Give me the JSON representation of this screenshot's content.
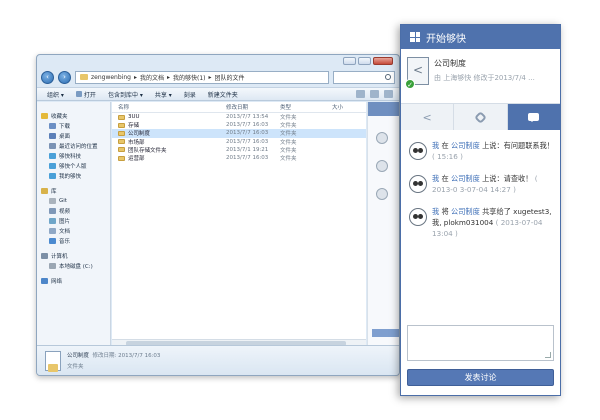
{
  "explorer": {
    "address": [
      "zengwenbing",
      "我的文档",
      "我的够快(1)",
      "团队的文件"
    ],
    "toolbar": {
      "organize": "组织 ▾",
      "open": "打开",
      "include_in_library": "包含到库中 ▾",
      "share": "共享 ▾",
      "burn": "刻录",
      "new_folder": "新建文件夹"
    },
    "nav": [
      {
        "label": "收藏夹",
        "head": true,
        "color": "#e4b93a"
      },
      {
        "label": "下载",
        "color": "#6c8fc4"
      },
      {
        "label": "桌面",
        "color": "#5b7fb8"
      },
      {
        "label": "最近访问的位置",
        "color": "#7b93b5"
      },
      {
        "label": "够快科技",
        "color": "#4aa0d8"
      },
      {
        "label": "够快个人版",
        "color": "#4aa0d8"
      },
      {
        "label": "我的够快",
        "color": "#4aa0d8"
      },
      {
        "label": "库",
        "head": true,
        "color": "#d8b24a"
      },
      {
        "label": "Git",
        "color": "#aab3bd"
      },
      {
        "label": "视频",
        "color": "#7f98b8"
      },
      {
        "label": "图片",
        "color": "#6fa6c9"
      },
      {
        "label": "文档",
        "color": "#8fa8c6"
      },
      {
        "label": "音乐",
        "color": "#4b8ad0"
      },
      {
        "label": "计算机",
        "head": true,
        "color": "#7c8fa6"
      },
      {
        "label": "本地磁盘 (C:)",
        "color": "#9aa6b3"
      },
      {
        "label": "网络",
        "head": true,
        "color": "#4d86c9"
      }
    ],
    "columns": {
      "name": "名称",
      "modified": "修改日期",
      "type": "类型",
      "size": "大小"
    },
    "files": [
      {
        "name": "3UU",
        "date": "2013/7/7 13:54",
        "type": "文件夹"
      },
      {
        "name": "存储",
        "date": "2013/7/7 16:03",
        "type": "文件夹"
      },
      {
        "name": "公司制度",
        "date": "2013/7/7 16:03",
        "type": "文件夹",
        "selected": true
      },
      {
        "name": "市场部",
        "date": "2013/7/7 16:03",
        "type": "文件夹"
      },
      {
        "name": "团队存储文件夹",
        "date": "2013/7/1 19:21",
        "type": "文件夹"
      },
      {
        "name": "运营部",
        "date": "2013/7/7 16:03",
        "type": "文件夹"
      }
    ],
    "details": {
      "name": "公司制度",
      "modified": "修改日期: 2013/7/7 16:03",
      "kind": "文件夹"
    }
  },
  "panel": {
    "title": "开始够快",
    "item_title": "公司制度",
    "item_sub": "由 上海够快 修改于2013/7/4 ...",
    "comment_placeholder": "",
    "post_label": "发表讨论",
    "messages": [
      {
        "actor": "我",
        "mid": "在",
        "target": "公司制度",
        "action": "上说：有问题联系我！",
        "time": "( 15:16 )"
      },
      {
        "actor": "我",
        "mid": "在",
        "target": "公司制度",
        "action": "上说：请查收！",
        "time": "( 2013-0 3-07-04 14:27 )"
      },
      {
        "actor": "我",
        "mid": "将",
        "target": "公司制度",
        "action": "共享给了 xugetest3, 我, plokm031004",
        "time": "( 2013-07-04 13:04 )"
      }
    ]
  }
}
